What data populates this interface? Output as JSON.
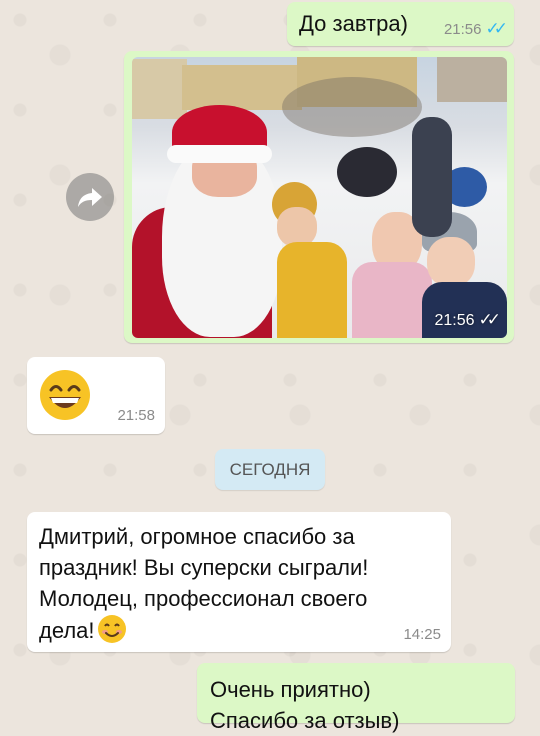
{
  "messages": [
    {
      "text": "До завтра)",
      "time": "21:56"
    },
    {
      "type": "photo",
      "time": "21:56"
    },
    {
      "emoji": "grinning-face-smiling-eyes",
      "time": "21:58"
    },
    {
      "lines": [
        "Дмитрий, огромное спасибо за",
        "праздник! Вы суперски сыграли!",
        "Молодец, профессионал своего",
        "дела!"
      ],
      "time": "14:25"
    },
    {
      "lines": [
        "Очень приятно)",
        "Спасибо за отзыв)"
      ]
    }
  ],
  "date_separator": "СЕГОДНЯ",
  "colors": {
    "outgoing": "#dcf8c6",
    "incoming": "#ffffff",
    "read_ticks": "#34b7f1",
    "chip": "#d4eaf4"
  },
  "icons": {
    "forward": "forward-icon",
    "ticks": "double-check-icon"
  }
}
